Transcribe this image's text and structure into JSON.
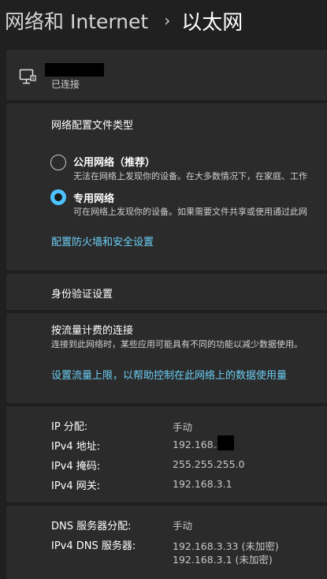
{
  "breadcrumb": {
    "parent": "网络和 Internet",
    "separator": "›",
    "current": "以太网"
  },
  "connection": {
    "icon": "ethernet-icon",
    "status": "已连接"
  },
  "network_profile": {
    "title": "网络配置文件类型",
    "options": [
      {
        "label": "公用网络（推荐）",
        "desc": "无法在网络上发现你的设备。在大多数情况下，在家庭、工作",
        "selected": false
      },
      {
        "label": "专用网络",
        "desc": "可在网络上发现你的设备。如果需要文件共享或使用通过此网",
        "selected": true
      }
    ],
    "firewall_link": "配置防火墙和安全设置"
  },
  "auth": {
    "title": "身份验证设置"
  },
  "metered": {
    "title": "按流量计费的连接",
    "desc": "连接到此网络时，某些应用可能具有不同的功能以减少数据使用。",
    "link": "设置流量上限，以帮助控制在此网络上的数据使用量"
  },
  "ip_props": [
    {
      "key": "IP 分配:",
      "value": "手动"
    },
    {
      "key": "IPv4 地址:",
      "value": "192.168.3."
    },
    {
      "key": "IPv4 掩码:",
      "value": "255.255.255.0"
    },
    {
      "key": "IPv4 网关:",
      "value": "192.168.3.1"
    }
  ],
  "dns_props": {
    "assign_key": "DNS 服务器分配:",
    "assign_value": "手动",
    "servers_key": "IPv4 DNS 服务器:",
    "server1": "192.168.3.33 (未加密)",
    "server2": "192.168.3.1 (未加密)"
  },
  "colors": {
    "background": "#202020",
    "card": "#2b2b2b",
    "accent": "#4cc2ff",
    "link": "#6ccff6"
  }
}
